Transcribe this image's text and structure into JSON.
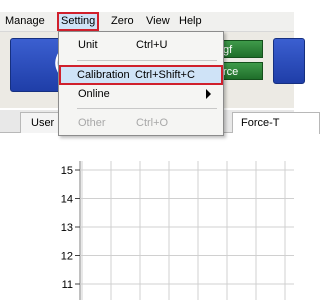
{
  "menubar": {
    "items": [
      {
        "label": "Manage",
        "mnemonic": "M"
      },
      {
        "label": "Setting",
        "mnemonic": "S"
      },
      {
        "label": "Zero",
        "mnemonic": "Z"
      },
      {
        "label": "View",
        "mnemonic": "V"
      },
      {
        "label": "Help",
        "mnemonic": "H"
      }
    ]
  },
  "toolbar": {
    "main_glyph": "(",
    "green_top_label": "gf",
    "green_bottom_label": "rce"
  },
  "setting_menu": {
    "items": [
      {
        "label": "Unit",
        "shortcut": "Ctrl+U",
        "state": "normal"
      },
      {
        "label": "Calibration",
        "shortcut": "Ctrl+Shift+C",
        "state": "highlighted"
      },
      {
        "label": "Online",
        "shortcut": "",
        "state": "submenu"
      },
      {
        "label": "Other",
        "shortcut": "Ctrl+O",
        "state": "disabled"
      }
    ]
  },
  "tabs": {
    "left_label": "User",
    "right_label": "Force-T"
  },
  "chart_data": {
    "type": "line",
    "y_ticks": [
      "15",
      "14",
      "13",
      "12",
      "11"
    ],
    "ylim": [
      11,
      15
    ],
    "grid": true,
    "series": []
  },
  "colors": {
    "highlight_border": "#d0202c",
    "highlight_fill": "#cfe3f7",
    "grid_line": "#d0d0d0"
  }
}
